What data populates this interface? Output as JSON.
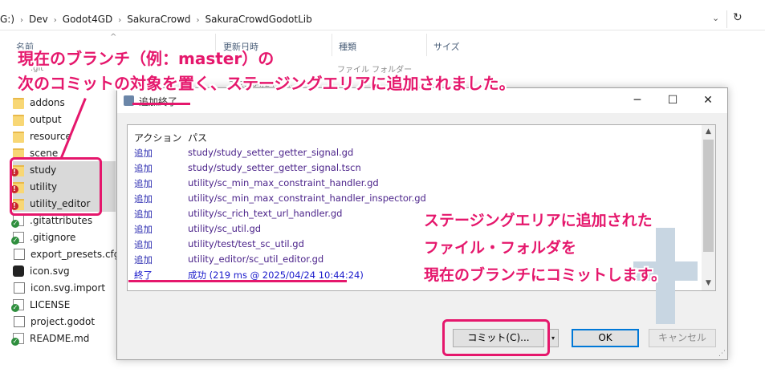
{
  "explorer": {
    "breadcrumb": [
      "G:)",
      "Dev",
      "Godot4GD",
      "SakuraCrowd",
      "SakuraCrowdGodotLib"
    ],
    "columns": {
      "name": "名前",
      "date": "更新日時",
      "type": "種類",
      "size": "サイズ"
    },
    "hidden_row": {
      "name": ".git",
      "date": "2025/04/24 10:...",
      "type": "ファイル フォルダー"
    },
    "files": [
      {
        "name": "addons",
        "icon": "folder-icon",
        "selected": false
      },
      {
        "name": "output",
        "icon": "folder-icon",
        "selected": false
      },
      {
        "name": "resource",
        "icon": "folder-icon",
        "selected": false
      },
      {
        "name": "scene",
        "icon": "folder-icon",
        "selected": false
      },
      {
        "name": "study",
        "icon": "folder-warning-icon",
        "selected": true
      },
      {
        "name": "utility",
        "icon": "folder-warning-icon",
        "selected": true
      },
      {
        "name": "utility_editor",
        "icon": "folder-warning-icon",
        "selected": true
      },
      {
        "name": ".gitattributes",
        "icon": "git-file-icon",
        "selected": false
      },
      {
        "name": ".gitignore",
        "icon": "git-file-icon",
        "selected": false
      },
      {
        "name": "export_presets.cfg",
        "icon": "file-icon",
        "selected": false
      },
      {
        "name": "icon.svg",
        "icon": "godot-icon",
        "selected": false
      },
      {
        "name": "icon.svg.import",
        "icon": "file-icon",
        "selected": false
      },
      {
        "name": "LICENSE",
        "icon": "git-file-icon",
        "selected": false
      },
      {
        "name": "project.godot",
        "icon": "file-icon",
        "selected": false
      },
      {
        "name": "README.md",
        "icon": "git-file-icon",
        "selected": false
      }
    ]
  },
  "annotations": {
    "top_line1": "現在のブランチ（例：master）の",
    "top_line2": "次のコミットの対象を置く、ステージングエリアに追加されました。",
    "right_line1": "ステージングエリアに追加された",
    "right_line2": "ファイル・フォルダを",
    "right_line3": "現在のブランチにコミットします。",
    "accent_color": "#e5176c"
  },
  "dialog": {
    "title": "追加終了",
    "window_buttons": {
      "minimize": "─",
      "maximize": "☐",
      "close": "✕"
    },
    "list": {
      "headers": {
        "action": "アクション",
        "path": "パス"
      },
      "rows": [
        {
          "action": "追加",
          "path": "study/study_setter_getter_signal.gd"
        },
        {
          "action": "追加",
          "path": "study/study_setter_getter_signal.tscn"
        },
        {
          "action": "追加",
          "path": "utility/sc_min_max_constraint_handler.gd"
        },
        {
          "action": "追加",
          "path": "utility/sc_min_max_constraint_handler_inspector.gd"
        },
        {
          "action": "追加",
          "path": "utility/sc_rich_text_url_handler.gd"
        },
        {
          "action": "追加",
          "path": "utility/sc_util.gd"
        },
        {
          "action": "追加",
          "path": "utility/test/test_sc_util.gd"
        },
        {
          "action": "追加",
          "path": "utility_editor/sc_util_editor.gd"
        }
      ],
      "final": {
        "action": "終了",
        "path": "成功 (219 ms @ 2025/04/24 10:44:24)"
      }
    },
    "buttons": {
      "commit": "コミット(C)...",
      "ok": "OK",
      "cancel": "キャンセル"
    }
  }
}
